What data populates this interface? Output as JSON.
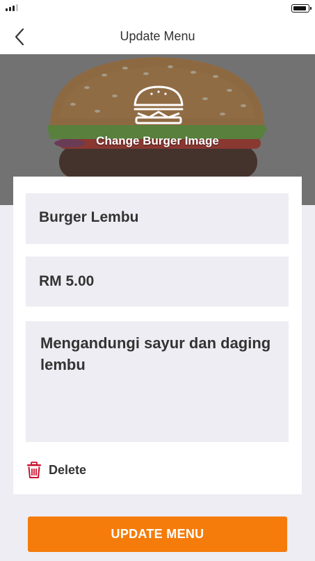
{
  "status_bar": {
    "signal": "signal-icon",
    "battery": "battery-icon"
  },
  "header": {
    "title": "Update Menu",
    "back_icon": "chevron-left-icon"
  },
  "hero": {
    "image": "burger-photo",
    "icon": "burger-icon",
    "change_label": "Change Burger Image"
  },
  "form": {
    "name": "Burger Lembu",
    "price": "RM 5.00",
    "description": "Mengandungi sayur dan daging lembu"
  },
  "delete": {
    "label": "Delete",
    "icon": "trash-icon",
    "color": "#c8102e"
  },
  "update_button": {
    "label": "UPDATE MENU",
    "color": "#f57c0b"
  }
}
